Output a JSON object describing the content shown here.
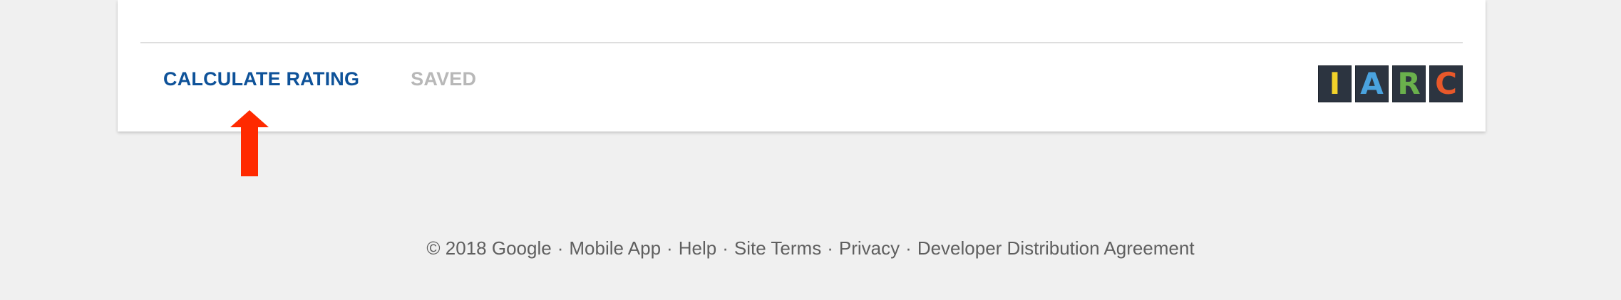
{
  "actions": {
    "calculate_label": "CALCULATE RATING",
    "saved_label": "SAVED",
    "calculate_color": "#0e5299",
    "saved_color": "#b8b8b8"
  },
  "iarc_logo": {
    "tiles": [
      {
        "letter": "I",
        "color": "#f2d22a"
      },
      {
        "letter": "A",
        "color": "#4aa3df"
      },
      {
        "letter": "R",
        "color": "#6ab04c"
      },
      {
        "letter": "C",
        "color": "#e8582a"
      }
    ]
  },
  "annotation": {
    "icon": "arrow-up-icon",
    "color": "#ff2a00"
  },
  "footer": {
    "copyright": "© 2018 Google",
    "separator": "·",
    "links": [
      "Mobile App",
      "Help",
      "Site Terms",
      "Privacy",
      "Developer Distribution Agreement"
    ]
  }
}
